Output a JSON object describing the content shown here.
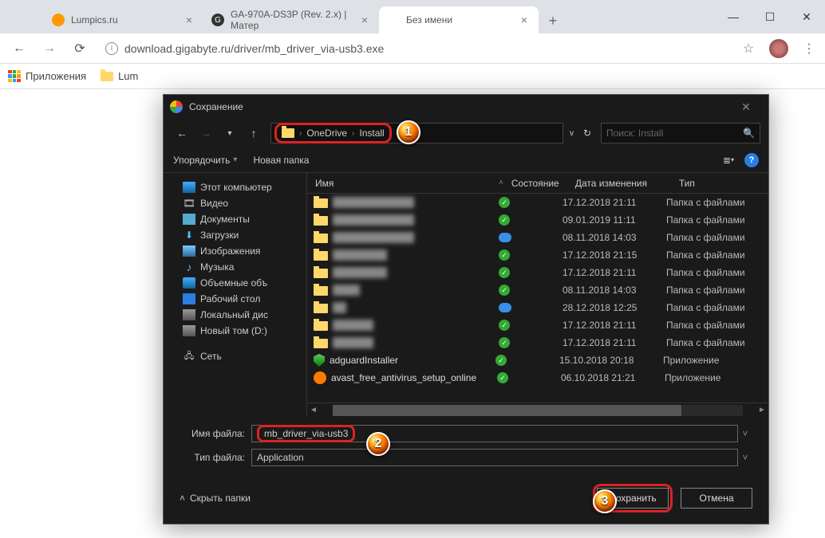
{
  "browser": {
    "tabs": [
      {
        "title": "Lumpics.ru",
        "icon_color": "#f90"
      },
      {
        "title": "GA-970A-DS3P (Rev. 2.x) | Матер",
        "icon_color": "#333"
      },
      {
        "title": "Без имени",
        "icon_color": "transparent",
        "active": true
      }
    ],
    "url": "download.gigabyte.ru/driver/mb_driver_via-usb3.exe",
    "bookmarks": {
      "apps": "Приложения",
      "folder1": "Lum"
    }
  },
  "dialog": {
    "title": "Сохранение",
    "breadcrumb": [
      "OneDrive",
      "Install"
    ],
    "search_placeholder": "Поиск: Install",
    "toolbar": {
      "organize": "Упорядочить",
      "newfolder": "Новая папка"
    },
    "tree": [
      {
        "icon": "pc",
        "label": "Этот компьютер"
      },
      {
        "icon": "video",
        "label": "Видео"
      },
      {
        "icon": "doc",
        "label": "Документы"
      },
      {
        "icon": "dl",
        "label": "Загрузки"
      },
      {
        "icon": "img",
        "label": "Изображения"
      },
      {
        "icon": "music",
        "label": "Музыка"
      },
      {
        "icon": "disk",
        "label": "Объемные объ"
      },
      {
        "icon": "desk",
        "label": "Рабочий стол"
      },
      {
        "icon": "hdd",
        "label": "Локальный дис"
      },
      {
        "icon": "hdd",
        "label": "Новый том (D:)"
      }
    ],
    "network": "Сеть",
    "columns": {
      "name": "Имя",
      "state": "Состояние",
      "date": "Дата изменения",
      "type": "Тип"
    },
    "rows": [
      {
        "icon": "fold",
        "blur": true,
        "name": "████████████",
        "state": "check",
        "date": "17.12.2018 21:11",
        "type": "Папка с файлами"
      },
      {
        "icon": "fold",
        "blur": true,
        "name": "████████████",
        "state": "check",
        "date": "09.01.2019 11:11",
        "type": "Папка с файлами"
      },
      {
        "icon": "fold",
        "blur": true,
        "name": "████████████",
        "state": "cloud",
        "date": "08.11.2018 14:03",
        "type": "Папка с файлами"
      },
      {
        "icon": "fold",
        "blur": true,
        "name": "████████",
        "state": "check",
        "date": "17.12.2018 21:15",
        "type": "Папка с файлами"
      },
      {
        "icon": "fold",
        "blur": true,
        "name": "████████",
        "state": "check",
        "date": "17.12.2018 21:11",
        "type": "Папка с файлами"
      },
      {
        "icon": "fold",
        "blur": true,
        "name": "████",
        "state": "check",
        "date": "08.11.2018 14:03",
        "type": "Папка с файлами"
      },
      {
        "icon": "fold",
        "blur": true,
        "name": "██",
        "state": "cloud",
        "date": "28.12.2018 12:25",
        "type": "Папка с файлами"
      },
      {
        "icon": "fold",
        "blur": true,
        "name": "██████",
        "state": "check",
        "date": "17.12.2018 21:11",
        "type": "Папка с файлами"
      },
      {
        "icon": "fold",
        "blur": true,
        "name": "██████",
        "state": "check",
        "date": "17.12.2018 21:11",
        "type": "Папка с файлами"
      },
      {
        "icon": "shield",
        "blur": false,
        "name": "adguardInstaller",
        "state": "check",
        "date": "15.10.2018 20:18",
        "type": "Приложение"
      },
      {
        "icon": "avast",
        "blur": false,
        "name": "avast_free_antivirus_setup_online",
        "state": "check",
        "date": "06.10.2018 21:21",
        "type": "Приложение"
      }
    ],
    "fields": {
      "name_label": "Имя файла:",
      "name_value": "mb_driver_via-usb3",
      "type_label": "Тип файла:",
      "type_value": "Application"
    },
    "footer": {
      "hide": "Скрыть папки",
      "save": "Сохранить",
      "cancel": "Отмена"
    }
  },
  "annotations": {
    "b1": "1",
    "b2": "2",
    "b3": "3"
  }
}
